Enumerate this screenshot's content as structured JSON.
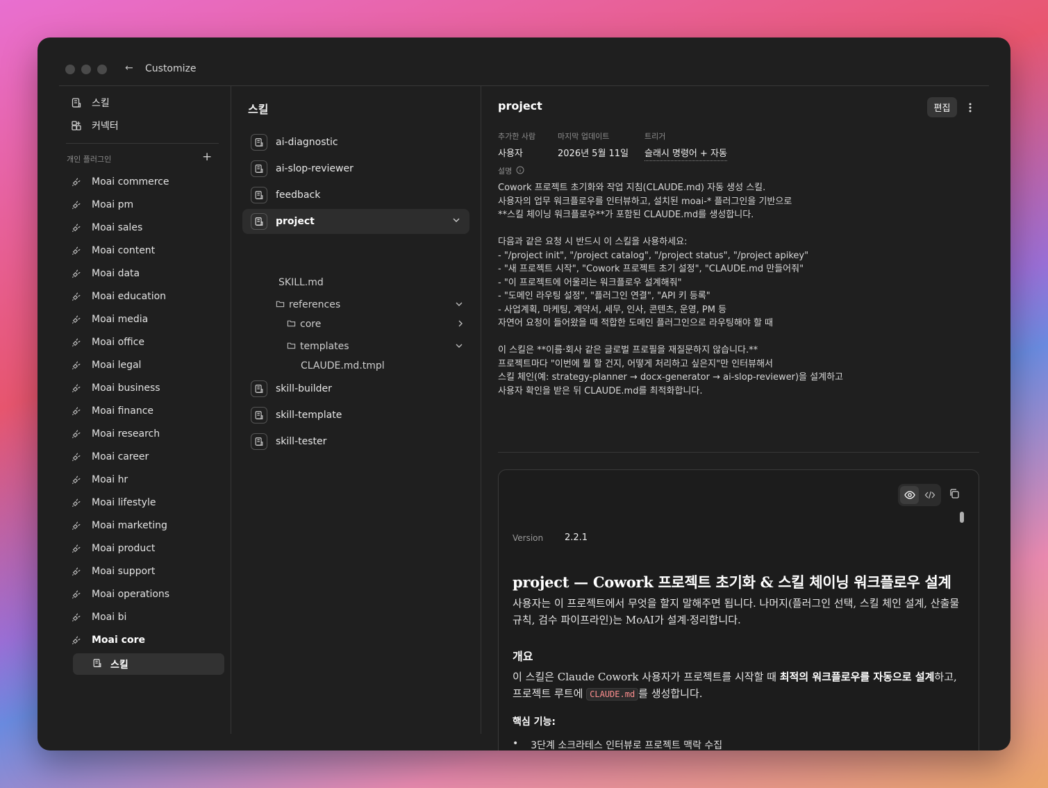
{
  "window": {
    "title": "Customize",
    "back_icon": "arrow-left-icon"
  },
  "sidebar": {
    "top_items": [
      {
        "label": "스킬",
        "icon": "skill-icon"
      },
      {
        "label": "커넥터",
        "icon": "connector-icon"
      }
    ],
    "plugins_header": "개인 플러그인",
    "plugins_add": "+",
    "plugins": [
      "Moai commerce",
      "Moai pm",
      "Moai sales",
      "Moai content",
      "Moai data",
      "Moai education",
      "Moai media",
      "Moai office",
      "Moai legal",
      "Moai business",
      "Moai finance",
      "Moai research",
      "Moai career",
      "Moai hr",
      "Moai lifestyle",
      "Moai marketing",
      "Moai product",
      "Moai support",
      "Moai operations",
      "Moai bi",
      "Moai core"
    ],
    "active_plugin_sub": "스킬"
  },
  "middle": {
    "title": "스킬",
    "skills": [
      "ai-diagnostic",
      "ai-slop-reviewer",
      "feedback",
      "project",
      "skill-builder",
      "skill-template",
      "skill-tester"
    ],
    "selected_skill": "project",
    "tree": {
      "skill_md": "SKILL.md",
      "references": "references",
      "core": "core",
      "templates": "templates",
      "template_file": "CLAUDE.md.tmpl"
    }
  },
  "detail": {
    "title": "project",
    "edit_label": "편집",
    "meta": {
      "added_by_label": "추가한 사람",
      "added_by": "사용자",
      "updated_label": "마지막 업데이트",
      "updated": "2026년 5월 11일",
      "trigger_label": "트리거",
      "trigger": "슬래시 명령어 + 자동"
    },
    "description_label": "설명",
    "description": "Cowork 프로젝트 초기화와 작업 지침(CLAUDE.md) 자동 생성 스킬.\n사용자의 업무 워크플로우를 인터뷰하고, 설치된 moai-* 플러그인을 기반으로\n**스킬 체이닝 워크플로우**가 포함된 CLAUDE.md를 생성합니다.\n\n다음과 같은 요청 시 반드시 이 스킬을 사용하세요:\n- \"/project init\", \"/project catalog\", \"/project status\", \"/project apikey\"\n- \"새 프로젝트 시작\", \"Cowork 프로젝트 초기 설정\", \"CLAUDE.md 만들어줘\"\n- \"이 프로젝트에 어울리는 워크플로우 설계해줘\"\n- \"도메인 라우팅 설정\", \"플러그인 연결\", \"API 키 등록\"\n- 사업계획, 마케팅, 계약서, 세무, 인사, 콘텐츠, 운영, PM 등\n자연어 요청이 들어왔을 때 적합한 도메인 플러그인으로 라우팅해야 할 때\n\n이 스킬은 **이름·회사 같은 글로벌 프로필을 재질문하지 않습니다.**\n프로젝트마다 \"이번에 뭘 할 건지, 어떻게 처리하고 싶은지\"만 인터뷰해서\n스킬 체인(예: strategy-planner → docx-generator → ai-slop-reviewer)을 설계하고\n사용자 확인을 받은 뒤 CLAUDE.md를 최적화합니다.",
    "preview": {
      "version_label": "Version",
      "version": "2.2.1",
      "h1": "project — Cowork 프로젝트 초기화 & 스킬 체이닝 워크플로우 설계",
      "intro": "사용자는 이 프로젝트에서 무엇을 할지 말해주면 됩니다. 나머지(플러그인 선택, 스킬 체인 설계, 산출물 규칙, 검수 파이프라인)는 MoAI가 설계·정리합니다.",
      "overview_heading": "개요",
      "overview_pre": "이 스킬은 Claude Cowork 사용자가 프로젝트를 시작할 때 ",
      "overview_strong": "최적의 워크플로우를 자동으로 설계",
      "overview_mid": "하고, 프로젝트 루트에 ",
      "overview_code": "CLAUDE.md",
      "overview_post": "를 생성합니다.",
      "features_heading": "핵심 기능:",
      "feature_1": "3단계 소크라테스 인터뷰로 프로젝트 맥락 수집"
    }
  }
}
